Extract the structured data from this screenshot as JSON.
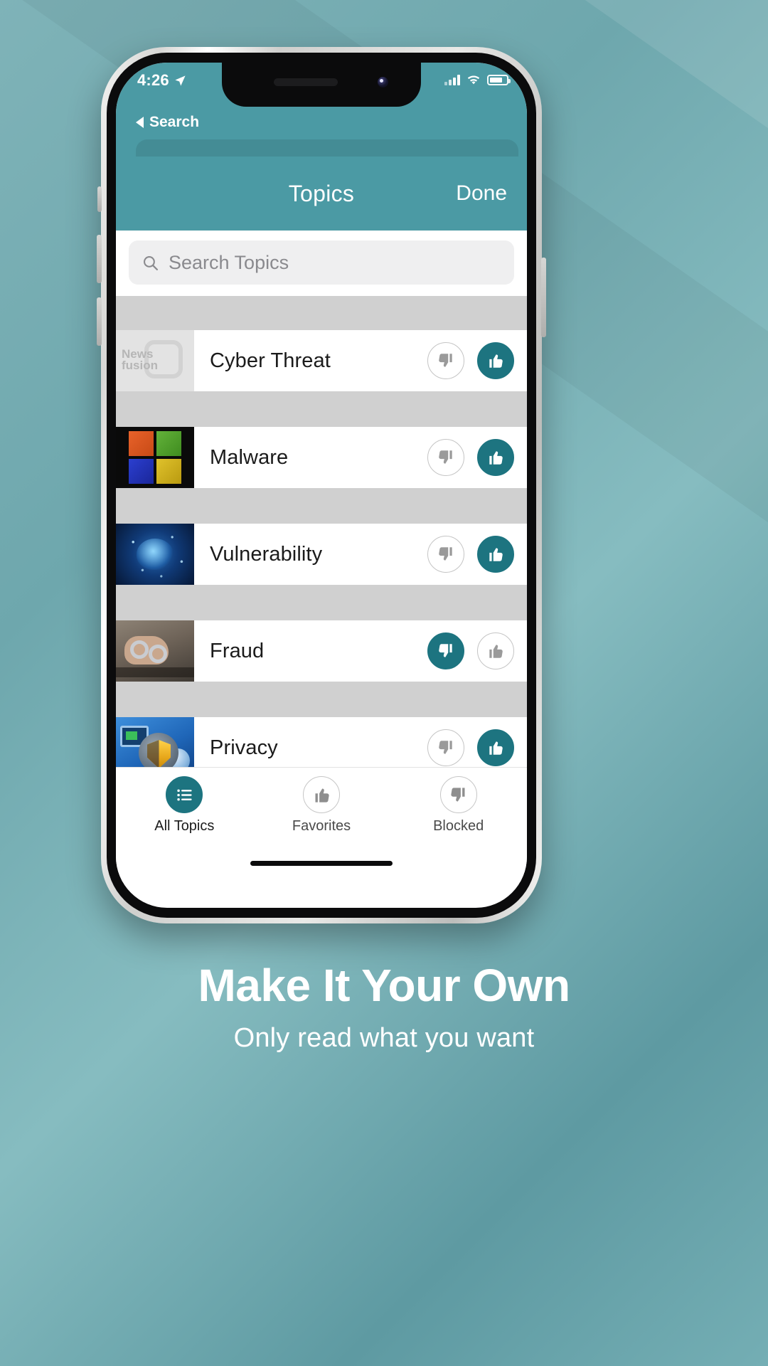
{
  "status_bar": {
    "time": "4:26",
    "location_icon": "location-arrow-icon",
    "signal_icon": "cellular-signal-icon",
    "wifi_icon": "wifi-icon",
    "battery_icon": "battery-icon"
  },
  "back_link": {
    "label": "Search",
    "icon": "back-triangle-icon"
  },
  "navbar": {
    "title": "Topics",
    "done_label": "Done"
  },
  "search": {
    "placeholder": "Search Topics",
    "value": "",
    "icon": "search-icon"
  },
  "topics": [
    {
      "title": "Cyber Threat",
      "thumbnail": "newsfusion-placeholder-logo",
      "logo_line1": "News",
      "logo_line2": "fusion",
      "favorited": true,
      "blocked": false
    },
    {
      "title": "Malware",
      "thumbnail": "colored-squares-image",
      "favorited": true,
      "blocked": false
    },
    {
      "title": "Vulnerability",
      "thumbnail": "blue-network-brain-image",
      "favorited": true,
      "blocked": false
    },
    {
      "title": "Fraud",
      "thumbnail": "handcuffs-image",
      "favorited": false,
      "blocked": true
    },
    {
      "title": "Privacy",
      "thumbnail": "blue-shield-security-image",
      "favorited": true,
      "blocked": false
    }
  ],
  "row_actions": {
    "thumbs_down_icon": "thumbs-down-icon",
    "thumbs_up_icon": "thumbs-up-icon"
  },
  "tabbar": [
    {
      "label": "All Topics",
      "icon": "list-icon",
      "active": true
    },
    {
      "label": "Favorites",
      "icon": "thumbs-up-icon",
      "active": false
    },
    {
      "label": "Blocked",
      "icon": "thumbs-down-icon",
      "active": false
    }
  ],
  "footer": {
    "headline": "Make It Your Own",
    "subhead": "Only read what you want"
  },
  "colors": {
    "teal_header": "#4b9aa4",
    "teal_accent": "#1d7480",
    "list_gap_gray": "#d0d0d0",
    "search_field_gray": "#efeff0",
    "background_teal": "#6ea7ad"
  }
}
